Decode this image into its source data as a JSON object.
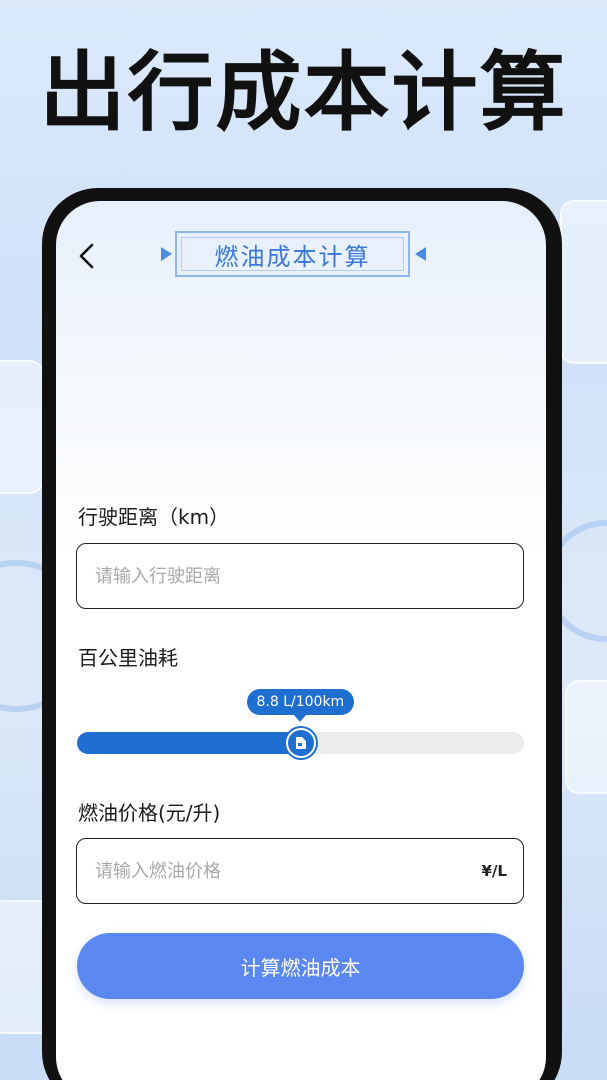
{
  "headline": "出行成本计算",
  "nav": {
    "title": "燃油成本计算",
    "back_icon": "chevron-left-icon"
  },
  "distance": {
    "label": "行驶距离（km）",
    "placeholder": "请输入行驶距离",
    "value": ""
  },
  "consumption": {
    "label": "百公里油耗",
    "value_text": "8.8 L/100km",
    "fraction": 0.5,
    "thumb_icon": "fuel-pump-icon"
  },
  "fuel_price": {
    "label": "燃油价格(元/升)",
    "placeholder": "请输入燃油价格",
    "value": "",
    "unit": "¥/L"
  },
  "calculate_button": "计算燃油成本",
  "colors": {
    "accent": "#1e6fd0",
    "button": "#5a87f0",
    "title": "#3b78d8"
  }
}
